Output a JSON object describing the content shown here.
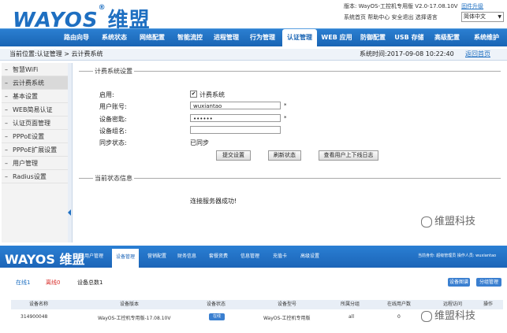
{
  "header": {
    "logo_text": "WAYOS",
    "logo_reg": "®",
    "logo_cn": "维盟",
    "version_text": "版本: WayOS-工控机专用版 V2.0-17.08.10V",
    "upgrade_link": "固件升级",
    "links": [
      "系统首页",
      "帮助中心",
      "安全退出",
      "选择语言"
    ],
    "language": "简体中文"
  },
  "nav": {
    "items": [
      "路由向导",
      "系统状态",
      "网络配置",
      "智能流控",
      "进程管理",
      "行为管理",
      "认证管理",
      "WEB 应用",
      "防御配置",
      "USB 存储",
      "高级配置",
      "系统维护"
    ],
    "active_index": 6
  },
  "breadcrumb": {
    "location": "当前位置:认证管理  >  云计费系统",
    "system_time": "系统时间:2017-09-08 10:22:40",
    "home_link": "返回首页"
  },
  "sidebar": {
    "items": [
      "智慧WiFi",
      "云计费系统",
      "基本设置",
      "WEB简易认证",
      "认证页面管理",
      "PPPoE设置",
      "PPPoE扩展设置",
      "用户管理",
      "Radius设置"
    ],
    "active_index": 1
  },
  "form": {
    "section_title": "计费系统设置",
    "enable_label": "启用:",
    "enable_checkbox_label": "计费系统",
    "enable_checked": "✔",
    "account_label": "用户账号:",
    "account_value": "wuxiantao",
    "password_label": "设备密匙:",
    "password_value": "••••••",
    "group_label": "设备组名:",
    "group_value": "",
    "sync_label": "同步状态:",
    "sync_value": "已同步",
    "required_mark": "*",
    "buttons": [
      "提交设置",
      "刷新状态",
      "查看用户上下线日志"
    ]
  },
  "status_section": {
    "title": "当前状态信息",
    "message": "连接服务器成功!"
  },
  "watermark": {
    "text": "维盟科技"
  },
  "bottom": {
    "logo_text": "WAYOS",
    "logo_cn": "维盟",
    "nav_items": [
      "用户管理",
      "设备管理",
      "营销配置",
      "财务信息",
      "套餐资费",
      "信息管理",
      "充值卡",
      "高级设置"
    ],
    "active_index": 1,
    "user_info": "当前身份: 超级管理员  操作人员: wuxiantao",
    "status_tabs": [
      "在线1",
      "离线0",
      "设备总数1"
    ],
    "buttons": [
      "设备图谱",
      "分组管理"
    ],
    "columns": [
      "设备名称",
      "设备版本",
      "设备状态",
      "设备型号",
      "所属分组",
      "在线用户数",
      "远程访问",
      "操作"
    ],
    "row": {
      "name": "314900048",
      "version": "WayOS-工控机专用版-17.08.10V",
      "status": "在线",
      "model": "WayOS-工控机专用版",
      "group": "all",
      "online_users": "0"
    }
  },
  "colors": {
    "brand_blue": "#1e6fc1",
    "nav_blue": "#1964b4",
    "status_red": "#d9302c"
  }
}
